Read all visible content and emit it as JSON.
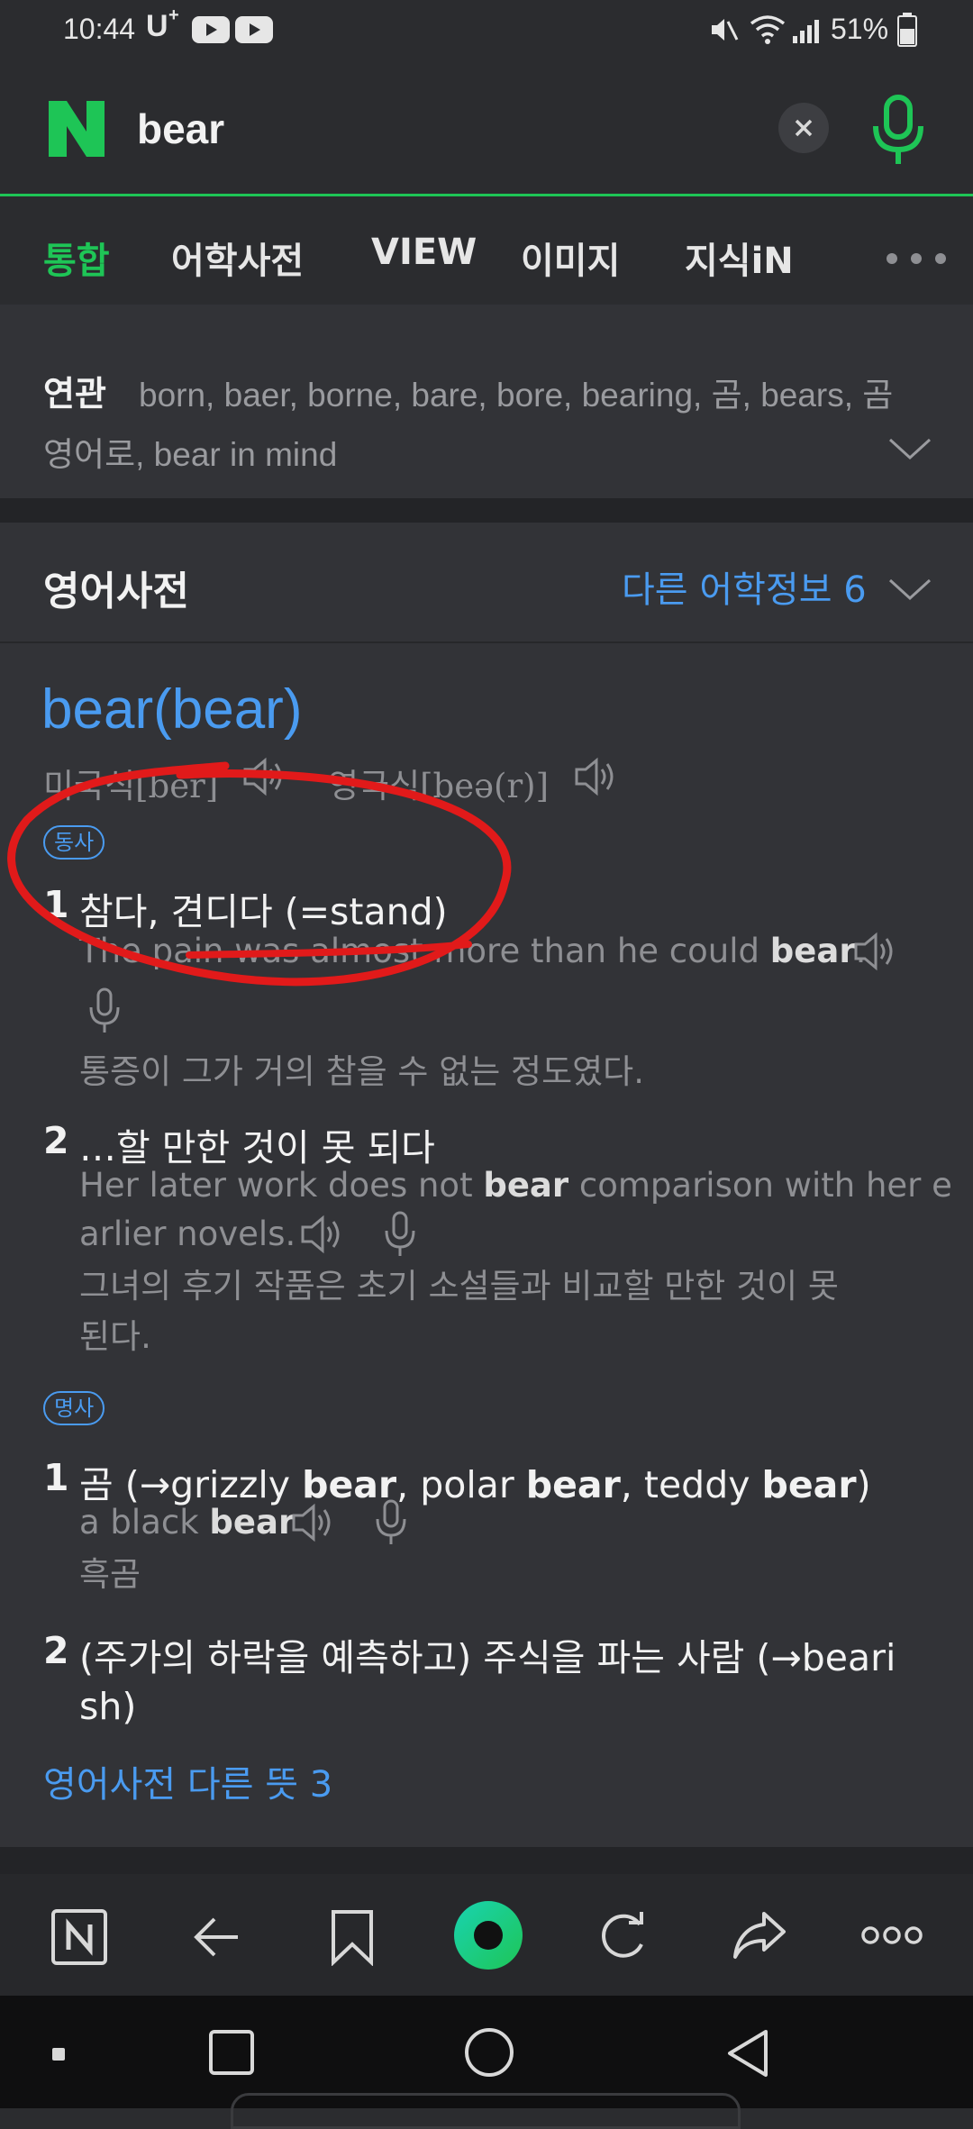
{
  "status_bar": {
    "time": "10:44",
    "carrier": "U",
    "battery": "51%"
  },
  "search": {
    "logo": "N",
    "query": "bear",
    "clear_icon": "close-icon",
    "voice_icon": "microphone-icon"
  },
  "tabs": {
    "items": [
      "통합",
      "어학사전",
      "VIEW",
      "이미지",
      "지식iN"
    ],
    "active": "통합",
    "more_icon": "more-horizontal-icon"
  },
  "related": {
    "label": "연관",
    "line1": "born, baer, borne, bare, bore, bearing, 곰, bears, 곰",
    "line2": "영어로, bear in mind"
  },
  "dictionary": {
    "section_title": "영어사전",
    "other_info": "다른 어학정보 6",
    "headword": "bear(bear)",
    "pron_us": "미국식[ber]",
    "pron_uk": "영국식[beə(r)]",
    "verb": {
      "badge": "동사",
      "senses": [
        {
          "num": "1",
          "meaning": "참다, 견디다 (=stand)",
          "example_pre": "The pain was almost more than he could ",
          "example_bold": "bear",
          "example_post": ".",
          "translation": "통증이 그가 거의 참을 수 없는 정도였다."
        },
        {
          "num": "2",
          "meaning": "…할 만한 것이 못 되다",
          "example_pre": "Her later work does not ",
          "example_bold": "bear",
          "example_post": " comparison with her e",
          "example_line2": "arlier novels.",
          "translation_line1": "그녀의 후기 작품은 초기 소설들과 비교할 만한 것이 못",
          "translation_line2": "된다."
        }
      ]
    },
    "noun": {
      "badge": "명사",
      "senses": [
        {
          "num": "1",
          "meaning_parts": [
            "곰 (→grizzly ",
            "bear",
            ", polar ",
            "bear",
            ", teddy ",
            "bear",
            ")"
          ],
          "example_pre": "a black ",
          "example_bold": "bear",
          "translation": "흑곰"
        },
        {
          "num": "2",
          "meaning_line1": "(주가의 하락을 예측하고) 주식을 파는 사람 (→beari",
          "meaning_line2": "sh)"
        }
      ]
    },
    "more_link": "영어사전 다른 뜻 3"
  },
  "bottom_nav": {
    "items": [
      "naver-home-icon",
      "back-arrow-icon",
      "bookmark-icon",
      "green-dot-icon",
      "refresh-icon",
      "share-icon",
      "more-icon"
    ]
  },
  "system_nav": {
    "items": [
      "recent-apps-icon",
      "home-icon",
      "back-icon"
    ]
  },
  "colors": {
    "naver_green": "#1ec556",
    "link_blue": "#4a9bf0",
    "annotation_red": "#e11a1a"
  }
}
